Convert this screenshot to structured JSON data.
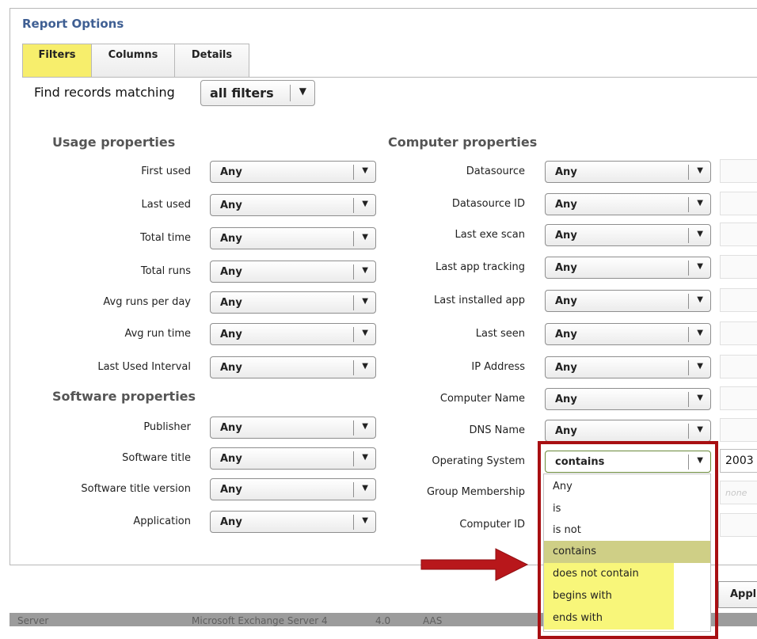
{
  "panel": {
    "title": "Report Options"
  },
  "tabs": [
    {
      "label": "Filters",
      "active": true
    },
    {
      "label": "Columns",
      "active": false
    },
    {
      "label": "Details",
      "active": false
    }
  ],
  "match": {
    "label": "Find records matching",
    "value": "all filters"
  },
  "sections": {
    "usage": "Usage properties",
    "software": "Software properties",
    "computer": "Computer properties"
  },
  "usage_filters": [
    {
      "label": "First used",
      "value": "Any"
    },
    {
      "label": "Last used",
      "value": "Any"
    },
    {
      "label": "Total time",
      "value": "Any"
    },
    {
      "label": "Total runs",
      "value": "Any"
    },
    {
      "label": "Avg runs per day",
      "value": "Any"
    },
    {
      "label": "Avg run time",
      "value": "Any"
    },
    {
      "label": "Last Used Interval",
      "value": "Any"
    }
  ],
  "software_filters": [
    {
      "label": "Publisher",
      "value": "Any"
    },
    {
      "label": "Software title",
      "value": "Any"
    },
    {
      "label": "Software title version",
      "value": "Any"
    },
    {
      "label": "Application",
      "value": "Any"
    }
  ],
  "computer_filters": [
    {
      "label": "Datasource",
      "value": "Any"
    },
    {
      "label": "Datasource ID",
      "value": "Any"
    },
    {
      "label": "Last exe scan",
      "value": "Any"
    },
    {
      "label": "Last app tracking",
      "value": "Any"
    },
    {
      "label": "Last installed app",
      "value": "Any"
    },
    {
      "label": "Last seen",
      "value": "Any"
    },
    {
      "label": "IP Address",
      "value": "Any"
    },
    {
      "label": "Computer Name",
      "value": "Any"
    },
    {
      "label": "DNS Name",
      "value": "Any"
    },
    {
      "label": "Operating System",
      "value": "contains",
      "text": "2003"
    },
    {
      "label": "Group Membership",
      "placeholder": "none"
    },
    {
      "label": "Computer ID"
    }
  ],
  "os_dropdown": {
    "options": [
      "Any",
      "is",
      "is not",
      "contains",
      "does not contain",
      "begins with",
      "ends with"
    ],
    "selected": "contains",
    "highlighted": [
      "does not contain",
      "begins with",
      "ends with"
    ]
  },
  "apply_button": "Appl",
  "table_row": [
    "Server",
    "Microsoft Exchange Server 4",
    "4.0",
    "AAS"
  ],
  "colors": {
    "title": "#3f5f93",
    "active_tab": "#f7ee6c",
    "callout": "#a80f12",
    "highlight": "#f8f67a",
    "selected": "#cfcf86"
  },
  "icons": [
    "dropdown-arrow-icon",
    "callout-arrow-icon"
  ]
}
